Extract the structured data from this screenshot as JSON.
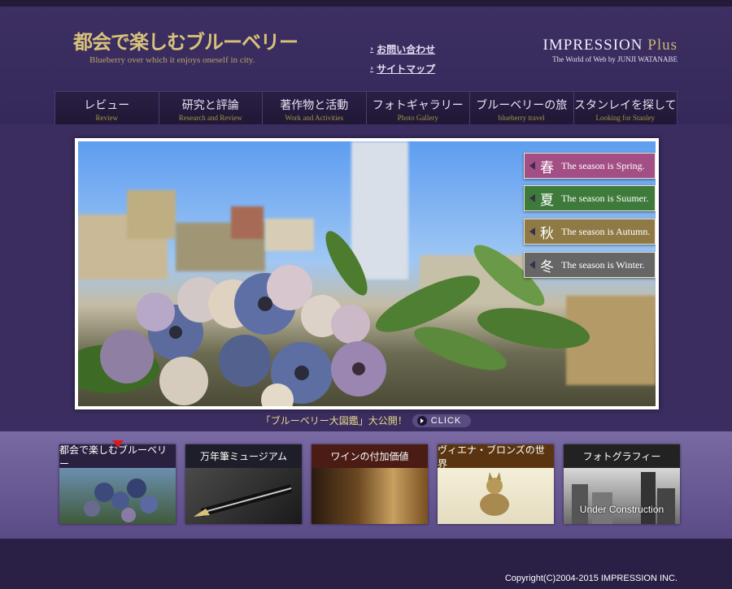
{
  "site": {
    "logo_title": "都会で楽しむブルーベリー",
    "logo_subtitle": "Blueberry over which it enjoys oneself in city."
  },
  "header_links": [
    {
      "label": "お問い合わせ"
    },
    {
      "label": "サイトマップ"
    }
  ],
  "brand": {
    "name": "IMPRESSION",
    "plus": "Plus",
    "tagline": "The World of Web by JUNJI WATANABE"
  },
  "nav": [
    {
      "jp": "レビュー",
      "en": "Review"
    },
    {
      "jp": "研究と評論",
      "en": "Research and Review"
    },
    {
      "jp": "著作物と活動",
      "en": "Work and Activities"
    },
    {
      "jp": "フォトギャラリー",
      "en": "Photo Gallery"
    },
    {
      "jp": "ブルーベリーの旅",
      "en": "blueberry travel"
    },
    {
      "jp": "スタンレイを探して",
      "en": "Looking for Stanley"
    }
  ],
  "seasons": [
    {
      "kanji": "春",
      "label": "The season is Spring.",
      "color": "#a34f86"
    },
    {
      "kanji": "夏",
      "label": "The season is Suumer.",
      "color": "#3e7a3a"
    },
    {
      "kanji": "秋",
      "label": "The season is Autumn.",
      "color": "#8f7a45"
    },
    {
      "kanji": "冬",
      "label": "The season is Winter.",
      "color": "#666666"
    }
  ],
  "caption": {
    "text": "「ブルーベリー大図鑑」大公開！",
    "button": "CLICK"
  },
  "cards": [
    {
      "title": "都会で楽しむブルーベリー",
      "title_bg": "#2a2040",
      "overlay": ""
    },
    {
      "title": "万年筆ミュージアム",
      "title_bg": "#1e1e2a",
      "overlay": ""
    },
    {
      "title": "ワインの付加価値",
      "title_bg": "#4a1c14",
      "overlay": ""
    },
    {
      "title": "ヴィエナ・ブロンズの世界",
      "title_bg": "#5a3410",
      "overlay": ""
    },
    {
      "title": "フォトグラフィー",
      "title_bg": "#222222",
      "overlay": "Under Construction"
    }
  ],
  "footer": {
    "copyright": "Copyright(C)2004-2015 IMPRESSION INC."
  }
}
